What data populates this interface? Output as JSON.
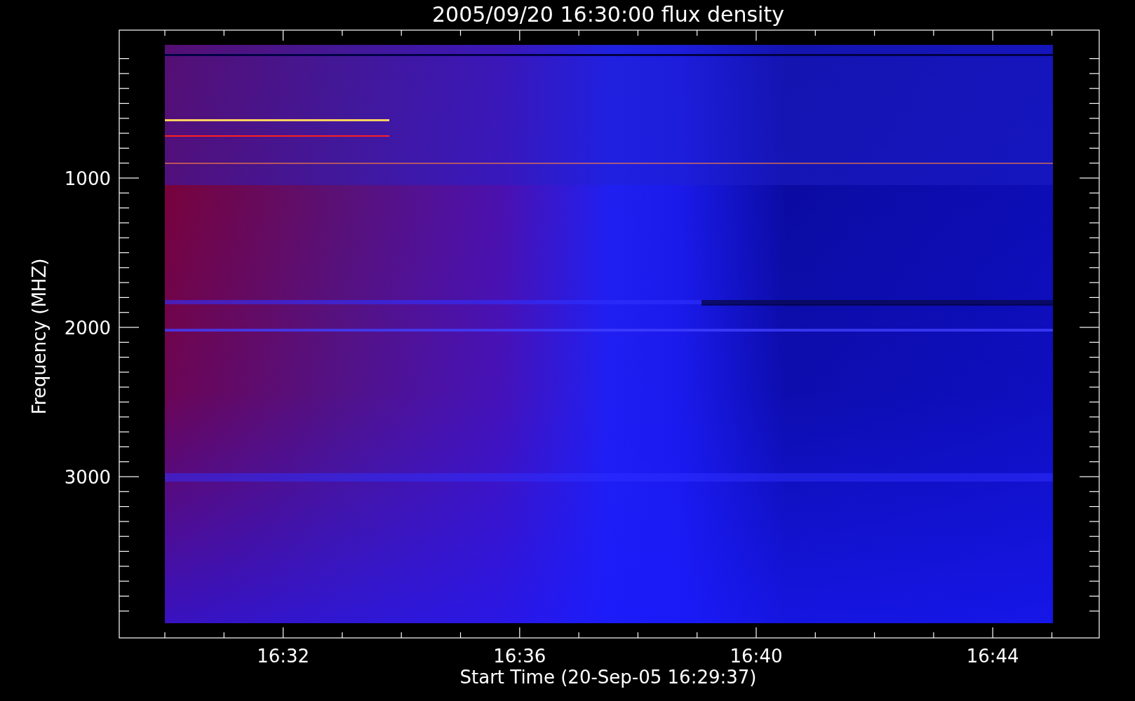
{
  "title": "2005/09/20 16:30:00 flux density",
  "y_axis": {
    "label": "Frequency (MHZ)",
    "ticks": [
      "1000",
      "2000",
      "3000"
    ]
  },
  "x_axis": {
    "label": "Start Time (20-Sep-05 16:29:37)",
    "ticks": [
      "16:32",
      "16:36",
      "16:40",
      "16:44"
    ]
  }
}
